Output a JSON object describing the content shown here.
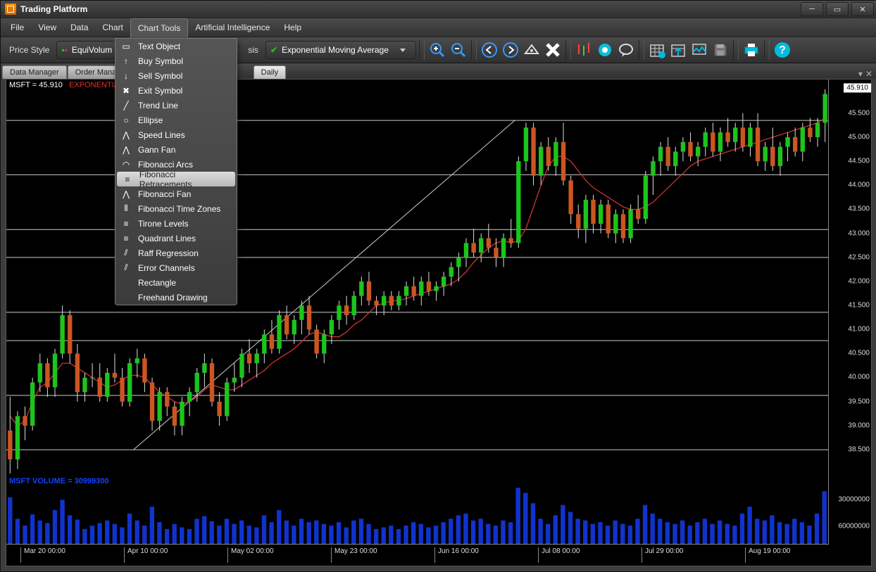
{
  "title": "Trading Platform",
  "menus": {
    "file": "File",
    "view": "View",
    "data": "Data",
    "chart": "Chart",
    "ctools": "Chart Tools",
    "ai": "Artificial Intelligence",
    "help": "Help"
  },
  "toolbar": {
    "pricestyle": "Price Style",
    "equivol": "EquiVolum",
    "tasuffix": "sis",
    "ema": "Exponential Moving Average"
  },
  "tabs": {
    "dm": "Data Manager",
    "om": "Order Manage",
    "daily": "Daily"
  },
  "dropdown": {
    "text": "Text Object",
    "buy": "Buy Symbol",
    "sell": "Sell Symbol",
    "exit": "Exit Symbol",
    "trend": "Trend Line",
    "ellipse": "Ellipse",
    "speed": "Speed Lines",
    "gann": "Gann Fan",
    "fibarcs": "Fibonacci Arcs",
    "fibretr": "Fibonacci Retracements",
    "fibfan": "Fibonacci Fan",
    "fibtime": "Fibonacci Time Zones",
    "tirone": "Tirone Levels",
    "quad": "Quadrant Lines",
    "raff": "Raff Regression",
    "err": "Error Channels",
    "rect": "Rectangle",
    "freehand": "Freehand Drawing"
  },
  "chartinfo": {
    "sym": "MSFT = 45.910",
    "ema": "EXPONENTIAL"
  },
  "volinfo": "MSFT VOLUME = 30999300",
  "ycur": "45.910",
  "yticks": [
    "45.500",
    "45.000",
    "44.500",
    "44.000",
    "43.500",
    "43.000",
    "42.500",
    "42.000",
    "41.500",
    "41.000",
    "40.500",
    "40.000",
    "39.500",
    "39.000",
    "38.500"
  ],
  "volticks": [
    "60000000",
    "30000000"
  ],
  "xticks": [
    "Mar 20 00:00",
    "Apr 10 00:00",
    "May 02 00:00",
    "May 23 00:00",
    "Jun 16 00:00",
    "Jul 08 00:00",
    "Jul 29 00:00",
    "Aug 19 00:00"
  ],
  "chart_data": {
    "type": "candlestick",
    "symbol": "MSFT",
    "period": "Daily",
    "ylim": [
      38.0,
      46.2
    ],
    "fib_levels": [
      38.5,
      39.63,
      40.77,
      41.36,
      42.5,
      43.08,
      44.22,
      45.35
    ],
    "fib_low_x": 17,
    "fib_high_x": 68,
    "fib_low_y": 38.5,
    "fib_high_y": 45.35,
    "ema": [
      39.2,
      39.0,
      39.1,
      39.5,
      39.8,
      39.9,
      40.1,
      40.3,
      40.3,
      40.2,
      40.1,
      40.0,
      39.9,
      39.8,
      39.85,
      39.95,
      40.05,
      40.05,
      40.0,
      39.85,
      39.7,
      39.6,
      39.5,
      39.45,
      39.5,
      39.6,
      39.75,
      39.85,
      39.8,
      39.75,
      39.75,
      39.85,
      39.95,
      40.05,
      40.15,
      40.3,
      40.4,
      40.5,
      40.6,
      40.75,
      40.9,
      40.95,
      40.9,
      40.85,
      40.85,
      40.95,
      41.1,
      41.2,
      41.35,
      41.5,
      41.55,
      41.6,
      41.6,
      41.65,
      41.7,
      41.75,
      41.8,
      41.85,
      41.9,
      41.95,
      42.05,
      42.2,
      42.4,
      42.55,
      42.7,
      42.8,
      42.85,
      42.8,
      42.85,
      43.1,
      43.55,
      44.0,
      44.4,
      44.6,
      44.6,
      44.5,
      44.3,
      44.1,
      43.95,
      43.85,
      43.75,
      43.65,
      43.55,
      43.5,
      43.5,
      43.55,
      43.65,
      43.8,
      43.95,
      44.1,
      44.25,
      44.4,
      44.5,
      44.55,
      44.6,
      44.65,
      44.7,
      44.75,
      44.8,
      44.85,
      44.9,
      44.95,
      45.0,
      45.05,
      45.1,
      45.15,
      45.2,
      45.25,
      45.3,
      45.4
    ],
    "candles": [
      [
        38.9,
        39.6,
        38.0,
        38.3
      ],
      [
        38.3,
        39.3,
        38.1,
        39.2
      ],
      [
        39.2,
        39.4,
        38.7,
        39.0
      ],
      [
        39.0,
        40.0,
        38.9,
        39.9
      ],
      [
        39.9,
        40.5,
        39.7,
        40.3
      ],
      [
        40.3,
        40.4,
        39.6,
        39.8
      ],
      [
        39.8,
        40.6,
        39.6,
        40.5
      ],
      [
        40.5,
        41.5,
        40.4,
        41.3
      ],
      [
        41.3,
        41.4,
        40.3,
        40.5
      ],
      [
        40.5,
        40.7,
        39.5,
        39.7
      ],
      [
        39.7,
        40.1,
        39.5,
        40.0
      ],
      [
        40.0,
        40.3,
        39.8,
        40.0
      ],
      [
        40.0,
        40.3,
        39.5,
        39.6
      ],
      [
        39.6,
        40.2,
        39.5,
        40.1
      ],
      [
        40.1,
        40.5,
        39.9,
        40.0
      ],
      [
        40.0,
        40.2,
        39.4,
        39.5
      ],
      [
        39.5,
        40.4,
        39.4,
        40.3
      ],
      [
        40.3,
        40.6,
        40.0,
        40.4
      ],
      [
        40.4,
        40.5,
        39.7,
        39.9
      ],
      [
        39.9,
        40.0,
        38.9,
        39.1
      ],
      [
        39.1,
        39.8,
        38.9,
        39.7
      ],
      [
        39.7,
        39.8,
        39.2,
        39.4
      ],
      [
        39.4,
        39.5,
        38.8,
        39.0
      ],
      [
        39.0,
        39.6,
        38.8,
        39.5
      ],
      [
        39.5,
        39.8,
        39.2,
        39.7
      ],
      [
        39.7,
        40.2,
        39.5,
        40.1
      ],
      [
        40.1,
        40.5,
        39.8,
        40.3
      ],
      [
        40.3,
        40.4,
        39.4,
        39.5
      ],
      [
        39.5,
        39.7,
        39.0,
        39.2
      ],
      [
        39.2,
        40.0,
        39.1,
        39.9
      ],
      [
        39.9,
        40.3,
        39.7,
        40.0
      ],
      [
        40.0,
        40.6,
        39.8,
        40.5
      ],
      [
        40.5,
        40.8,
        40.1,
        40.3
      ],
      [
        40.3,
        40.6,
        40.0,
        40.5
      ],
      [
        40.5,
        41.0,
        40.3,
        40.9
      ],
      [
        40.9,
        41.2,
        40.5,
        40.6
      ],
      [
        40.6,
        41.4,
        40.5,
        41.3
      ],
      [
        41.3,
        41.5,
        40.8,
        40.9
      ],
      [
        40.9,
        41.3,
        40.7,
        41.2
      ],
      [
        41.2,
        41.6,
        40.9,
        41.5
      ],
      [
        41.5,
        41.7,
        40.9,
        41.0
      ],
      [
        41.0,
        41.1,
        40.4,
        40.5
      ],
      [
        40.5,
        41.0,
        40.3,
        40.9
      ],
      [
        40.9,
        41.3,
        40.7,
        41.2
      ],
      [
        41.2,
        41.6,
        41.0,
        41.5
      ],
      [
        41.5,
        41.7,
        41.1,
        41.3
      ],
      [
        41.3,
        41.8,
        41.2,
        41.7
      ],
      [
        41.7,
        42.1,
        41.5,
        42.0
      ],
      [
        42.0,
        42.2,
        41.5,
        41.6
      ],
      [
        41.6,
        41.7,
        41.3,
        41.5
      ],
      [
        41.5,
        41.8,
        41.3,
        41.7
      ],
      [
        41.7,
        41.8,
        41.4,
        41.5
      ],
      [
        41.5,
        41.8,
        41.4,
        41.7
      ],
      [
        41.7,
        42.0,
        41.5,
        41.9
      ],
      [
        41.9,
        42.1,
        41.6,
        41.7
      ],
      [
        41.7,
        42.1,
        41.5,
        42.0
      ],
      [
        42.0,
        42.2,
        41.7,
        41.8
      ],
      [
        41.8,
        42.0,
        41.6,
        41.9
      ],
      [
        41.9,
        42.2,
        41.7,
        42.1
      ],
      [
        42.1,
        42.4,
        41.9,
        42.3
      ],
      [
        42.3,
        42.6,
        42.0,
        42.5
      ],
      [
        42.5,
        42.9,
        42.3,
        42.8
      ],
      [
        42.8,
        43.1,
        42.5,
        42.6
      ],
      [
        42.6,
        43.0,
        42.4,
        42.9
      ],
      [
        42.9,
        43.2,
        42.6,
        42.7
      ],
      [
        42.7,
        42.9,
        42.3,
        42.5
      ],
      [
        42.5,
        43.0,
        42.3,
        42.9
      ],
      [
        42.9,
        43.3,
        42.7,
        42.8
      ],
      [
        42.8,
        44.6,
        42.7,
        44.5
      ],
      [
        44.5,
        45.3,
        44.3,
        45.2
      ],
      [
        45.2,
        45.3,
        44.0,
        44.2
      ],
      [
        44.2,
        44.9,
        44.0,
        44.8
      ],
      [
        44.8,
        45.0,
        44.3,
        44.4
      ],
      [
        44.4,
        45.0,
        44.2,
        44.9
      ],
      [
        44.9,
        45.3,
        44.0,
        44.1
      ],
      [
        44.1,
        44.2,
        43.2,
        43.4
      ],
      [
        43.4,
        43.6,
        42.9,
        43.1
      ],
      [
        43.1,
        43.8,
        42.8,
        43.7
      ],
      [
        43.7,
        43.8,
        43.0,
        43.2
      ],
      [
        43.2,
        43.7,
        43.0,
        43.6
      ],
      [
        43.6,
        43.7,
        42.9,
        43.0
      ],
      [
        43.0,
        43.5,
        42.8,
        43.4
      ],
      [
        43.4,
        43.5,
        42.8,
        42.9
      ],
      [
        42.9,
        43.6,
        42.8,
        43.5
      ],
      [
        43.5,
        43.8,
        43.2,
        43.3
      ],
      [
        43.3,
        44.3,
        43.2,
        44.2
      ],
      [
        44.2,
        44.6,
        43.8,
        44.5
      ],
      [
        44.5,
        44.9,
        44.2,
        44.8
      ],
      [
        44.8,
        45.0,
        44.3,
        44.4
      ],
      [
        44.4,
        44.8,
        44.2,
        44.7
      ],
      [
        44.7,
        45.0,
        44.5,
        44.9
      ],
      [
        44.9,
        45.1,
        44.5,
        44.6
      ],
      [
        44.6,
        44.9,
        44.4,
        44.8
      ],
      [
        44.8,
        45.2,
        44.6,
        45.1
      ],
      [
        45.1,
        45.3,
        44.6,
        44.7
      ],
      [
        44.7,
        45.2,
        44.5,
        45.1
      ],
      [
        45.1,
        45.4,
        44.8,
        44.9
      ],
      [
        44.9,
        45.3,
        44.7,
        45.2
      ],
      [
        45.2,
        45.5,
        44.7,
        44.8
      ],
      [
        44.8,
        45.3,
        44.6,
        45.2
      ],
      [
        45.2,
        45.5,
        44.4,
        44.5
      ],
      [
        44.5,
        44.9,
        44.3,
        44.8
      ],
      [
        44.8,
        45.2,
        44.3,
        44.4
      ],
      [
        44.4,
        44.9,
        44.2,
        44.8
      ],
      [
        44.8,
        45.1,
        44.5,
        45.0
      ],
      [
        45.0,
        45.2,
        44.6,
        44.7
      ],
      [
        44.7,
        45.3,
        44.5,
        45.2
      ],
      [
        45.2,
        45.4,
        44.9,
        45.0
      ],
      [
        45.0,
        45.4,
        44.8,
        45.3
      ],
      [
        45.3,
        46.0,
        44.9,
        45.9
      ]
    ],
    "volume": [
      55,
      30,
      22,
      35,
      28,
      25,
      40,
      52,
      34,
      29,
      18,
      22,
      25,
      28,
      24,
      20,
      36,
      28,
      22,
      44,
      26,
      18,
      24,
      20,
      18,
      30,
      33,
      27,
      22,
      30,
      24,
      28,
      22,
      20,
      34,
      26,
      40,
      28,
      22,
      30,
      26,
      28,
      24,
      22,
      26,
      20,
      28,
      30,
      24,
      18,
      20,
      22,
      18,
      22,
      26,
      24,
      20,
      22,
      26,
      30,
      34,
      36,
      28,
      30,
      24,
      22,
      28,
      26,
      66,
      60,
      48,
      30,
      24,
      34,
      46,
      38,
      30,
      28,
      24,
      26,
      22,
      28,
      24,
      22,
      30,
      46,
      36,
      30,
      26,
      24,
      28,
      22,
      26,
      30,
      24,
      28,
      24,
      22,
      36,
      44,
      30,
      28,
      34,
      26,
      24,
      30,
      26,
      22,
      36,
      62
    ]
  }
}
